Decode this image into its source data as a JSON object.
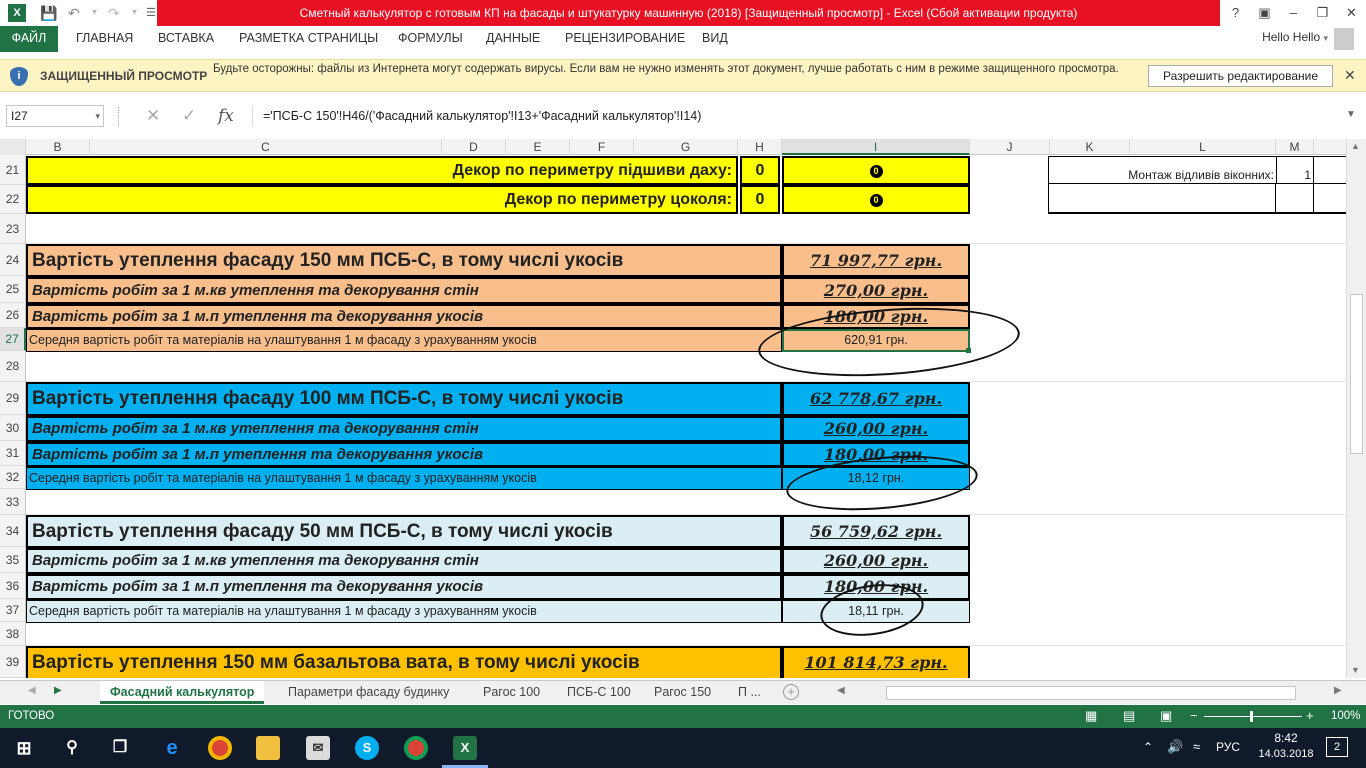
{
  "window": {
    "title": "Сметный калькулятор с готовым КП на фасады и штукатурку машинную (2018)  [Защищенный просмотр] -  Excel (Сбой активации продукта)",
    "help": "?",
    "minimize": "–",
    "restore": "❐",
    "close": "✕"
  },
  "ribbon": {
    "tabs": [
      "ФАЙЛ",
      "ГЛАВНАЯ",
      "ВСТАВКА",
      "РАЗМЕТКА СТРАНИЦЫ",
      "ФОРМУЛЫ",
      "ДАННЫЕ",
      "РЕЦЕНЗИРОВАНИЕ",
      "ВИД"
    ],
    "user": "Hello Hello"
  },
  "protected_view": {
    "title": "ЗАЩИЩЕННЫЙ ПРОСМОТР",
    "message": "Будьте осторожны: файлы из Интернета могут содержать вирусы. Если вам не нужно изменять этот документ, лучше работать с ним в режиме защищенного просмотра.",
    "enable_button": "Разрешить редактирование"
  },
  "formula_bar": {
    "name_box": "I27",
    "formula": "='ПСБ-С 150'!H46/('Фасадний калькулятор'!I13+'Фасадний калькулятор'!I14)"
  },
  "columns": [
    "B",
    "C",
    "D",
    "E",
    "F",
    "G",
    "H",
    "I",
    "J",
    "K",
    "L",
    "M"
  ],
  "rows": [
    "21",
    "22",
    "23",
    "24",
    "25",
    "26",
    "27",
    "28",
    "29",
    "30",
    "31",
    "32",
    "33",
    "34",
    "35",
    "36",
    "37",
    "38",
    "39"
  ],
  "cells": {
    "r21_label": "Декор по периметру підшиви даху:",
    "r21_h": "0",
    "r21_i": "0",
    "r22_label": "Декор по периметру цоколя:",
    "r22_h": "0",
    "r22_i": "0",
    "side_label": "Монтаж відливів віконних:",
    "side_value": "1",
    "r24_label": "Вартість утеплення фасаду 150 мм  ПСБ-С, в тому числі укосів",
    "r24_value": "71 997,77 грн.",
    "r25_label": "Вартість робіт за 1 м.кв утеплення та декорування стін",
    "r25_value": "270,00 грн.",
    "r26_label": "Вартість робіт за 1 м.п утеплення  та декорування укосів",
    "r26_value": "180,00 грн.",
    "r27_label": "Середня вартість робіт та матеріалів на улаштування 1 м фасаду з урахуванням укосів",
    "r27_value": "620,91 грн.",
    "r29_label": "Вартість утеплення фасаду 100 мм  ПСБ-С, в тому числі укосів",
    "r29_value": "62 778,67 грн.",
    "r30_label": "Вартість робіт за 1 м.кв утеплення та декорування стін",
    "r30_value": "260,00 грн.",
    "r31_label": "Вартість робіт за 1 м.п утеплення  та декорування укосів",
    "r31_value": "180,00 грн.",
    "r32_label": "Середня вартість робіт та матеріалів на улаштування 1 м фасаду з урахуванням укосів",
    "r32_value": "18,12 грн.",
    "r34_label": "Вартість утеплення фасаду 50 мм  ПСБ-С, в тому числі укосів",
    "r34_value": "56 759,62 грн.",
    "r35_label": "Вартість робіт за 1 м.кв утеплення та декорування стін",
    "r35_value": "260,00 грн.",
    "r36_label": "Вартість робіт за 1 м.п утеплення  та декорування укосів",
    "r36_value": "180,00 грн.",
    "r37_label": "Середня вартість робіт та матеріалів на улаштування 1 м фасаду з урахуванням укосів",
    "r37_value": "18,11 грн.",
    "r39_label": "Вартість утеплення 150 мм  базальтова вата, в тому числі укосів",
    "r39_value": "101 814,73 грн."
  },
  "sheet_tabs": [
    "Фасадний калькулятор",
    "Параметри фасаду будинку",
    "Pагос 100",
    "ПСБ-С 100",
    "Pагос 150",
    "П ..."
  ],
  "status": {
    "ready": "ГОТОВО",
    "zoom": "100%"
  },
  "taskbar": {
    "lang": "РУС",
    "time": "8:42",
    "date": "14.03.2018",
    "notifications": "2"
  },
  "colors": {
    "excel_green": "#217346",
    "title_red": "#e81123",
    "yellow": "#ffff00",
    "orange": "#f8bf8d",
    "blue": "#00b0f0",
    "light_blue": "#dbeef3",
    "gold": "#ffc000"
  }
}
